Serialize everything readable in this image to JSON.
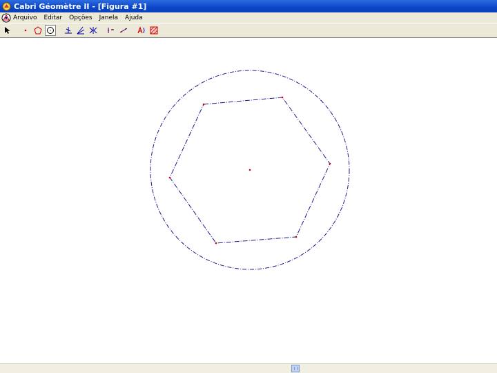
{
  "window": {
    "title": "Cabri Géomètre II - [Figura #1]"
  },
  "menubar": {
    "items": [
      "Arquivo",
      "Editar",
      "Opções",
      "Janela",
      "Ajuda"
    ]
  },
  "toolbar": {
    "tools": [
      {
        "icon": "pointer-icon",
        "active": false
      },
      {
        "icon": "point-icon",
        "active": false
      },
      {
        "icon": "polygon-icon",
        "active": false
      },
      {
        "icon": "circle-icon",
        "active": true
      },
      {
        "icon": "perpendicular-icon",
        "active": false
      },
      {
        "icon": "angle-bisector-icon",
        "active": false
      },
      {
        "icon": "symmetry-icon",
        "active": false
      },
      {
        "icon": "locus-icon",
        "active": false
      },
      {
        "icon": "measure-icon",
        "active": false
      },
      {
        "icon": "label-icon",
        "active": false
      },
      {
        "icon": "fill-icon",
        "active": false
      }
    ]
  },
  "colors": {
    "figure_stroke": "#1a1a8c",
    "figure_points": "#cc0000",
    "title_bar": "#0a46c8"
  }
}
